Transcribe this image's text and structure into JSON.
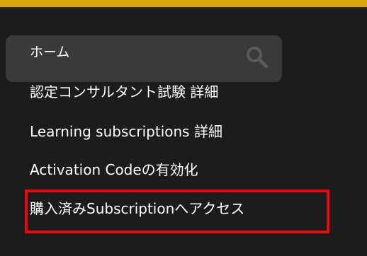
{
  "colors": {
    "background": "#1c1c1c",
    "accent_bar": "#d9a40c",
    "search_panel": "#3a3a3a",
    "highlight": "#ee0a0a",
    "text": "#ffffff"
  },
  "menu": {
    "items": [
      {
        "label": "ホーム"
      },
      {
        "label": "認定コンサルタント試験 詳細"
      },
      {
        "label": "Learning subscriptions 詳細"
      },
      {
        "label": "Activation Codeの有効化"
      },
      {
        "label": "購入済みSubscriptionへアクセス"
      }
    ]
  },
  "search": {
    "icon": "search-icon"
  },
  "highlight": {
    "target": "menu.items.4"
  }
}
